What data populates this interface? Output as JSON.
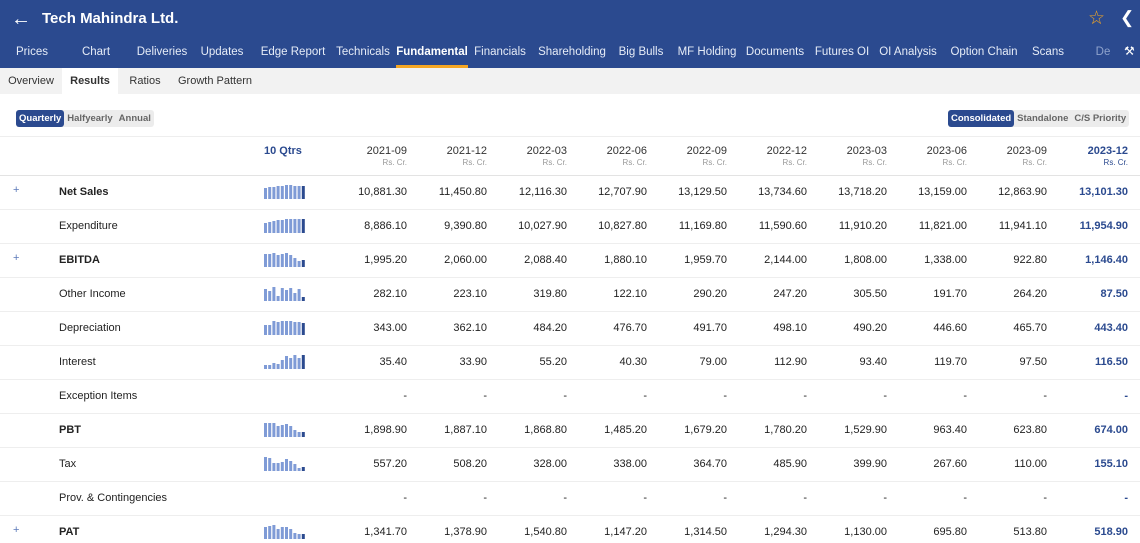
{
  "header": {
    "back_icon": "arrow-left-icon",
    "title": "Tech Mahindra Ltd.",
    "star_icon": "star-outline-icon",
    "share_icon": "share-icon",
    "settings_icon": "wrench-icon",
    "accent_color": "#2b4a8f",
    "highlight_color": "#f5a623"
  },
  "nav": {
    "tabs": [
      "Prices",
      "Chart",
      "Deliveries",
      "Updates",
      "Edge Report",
      "Technicals",
      "Fundamental",
      "Financials",
      "Shareholding",
      "Big Bulls",
      "MF Holding",
      "Documents",
      "Futures OI",
      "OI Analysis",
      "Option Chain",
      "Scans",
      "De"
    ],
    "active": "Fundamental"
  },
  "subnav": {
    "tabs": [
      "Overview",
      "Results",
      "Ratios",
      "Growth Pattern"
    ],
    "active": "Results"
  },
  "period_toggle": {
    "options": [
      "Quarterly",
      "Halfyearly",
      "Annual"
    ],
    "selected": "Quarterly"
  },
  "scope_toggle": {
    "options": [
      "Consolidated",
      "Standalone",
      "C/S Priority"
    ],
    "selected": "Consolidated"
  },
  "table": {
    "trend_header": "10 Qtrs",
    "unit": "Rs. Cr.",
    "periods": [
      "2021-09",
      "2021-12",
      "2022-03",
      "2022-06",
      "2022-09",
      "2022-12",
      "2023-03",
      "2023-06",
      "2023-09",
      "2023-12"
    ],
    "rows": [
      {
        "label": "Net Sales",
        "expandable": true,
        "bold": true,
        "values": [
          "10,881.30",
          "11,450.80",
          "12,116.30",
          "12,707.90",
          "13,129.50",
          "13,734.60",
          "13,718.20",
          "13,159.00",
          "12,863.90",
          "13,101.30"
        ],
        "spark": [
          10881.3,
          11450.8,
          12116.3,
          12707.9,
          13129.5,
          13734.6,
          13718.2,
          13159.0,
          12863.9,
          13101.3
        ]
      },
      {
        "label": "Expenditure",
        "expandable": false,
        "bold": false,
        "values": [
          "8,886.10",
          "9,390.80",
          "10,027.90",
          "10,827.80",
          "11,169.80",
          "11,590.60",
          "11,910.20",
          "11,821.00",
          "11,941.10",
          "11,954.90"
        ],
        "spark": [
          8886.1,
          9390.8,
          10027.9,
          10827.8,
          11169.8,
          11590.6,
          11910.2,
          11821.0,
          11941.1,
          11954.9
        ]
      },
      {
        "label": "EBITDA",
        "expandable": true,
        "bold": true,
        "values": [
          "1,995.20",
          "2,060.00",
          "2,088.40",
          "1,880.10",
          "1,959.70",
          "2,144.00",
          "1,808.00",
          "1,338.00",
          "922.80",
          "1,146.40"
        ],
        "spark": [
          1995.2,
          2060.0,
          2088.4,
          1880.1,
          1959.7,
          2144.0,
          1808.0,
          1338.0,
          922.8,
          1146.4
        ]
      },
      {
        "label": "Other Income",
        "expandable": false,
        "bold": false,
        "values": [
          "282.10",
          "223.10",
          "319.80",
          "122.10",
          "290.20",
          "247.20",
          "305.50",
          "191.70",
          "264.20",
          "87.50"
        ],
        "spark": [
          282.1,
          223.1,
          319.8,
          122.1,
          290.2,
          247.2,
          305.5,
          191.7,
          264.2,
          87.5
        ]
      },
      {
        "label": "Depreciation",
        "expandable": false,
        "bold": false,
        "values": [
          "343.00",
          "362.10",
          "484.20",
          "476.70",
          "491.70",
          "498.10",
          "490.20",
          "446.60",
          "465.70",
          "443.40"
        ],
        "spark": [
          343.0,
          362.1,
          484.2,
          476.7,
          491.7,
          498.1,
          490.2,
          446.6,
          465.7,
          443.4
        ]
      },
      {
        "label": "Interest",
        "expandable": false,
        "bold": false,
        "values": [
          "35.40",
          "33.90",
          "55.20",
          "40.30",
          "79.00",
          "112.90",
          "93.40",
          "119.70",
          "97.50",
          "116.50"
        ],
        "spark": [
          35.4,
          33.9,
          55.2,
          40.3,
          79.0,
          112.9,
          93.4,
          119.7,
          97.5,
          116.5
        ]
      },
      {
        "label": "Exception Items",
        "expandable": false,
        "bold": false,
        "values": [
          "-",
          "-",
          "-",
          "-",
          "-",
          "-",
          "-",
          "-",
          "-",
          "-"
        ],
        "spark": []
      },
      {
        "label": "PBT",
        "expandable": false,
        "bold": true,
        "values": [
          "1,898.90",
          "1,887.10",
          "1,868.80",
          "1,485.20",
          "1,679.20",
          "1,780.20",
          "1,529.90",
          "963.40",
          "623.80",
          "674.00"
        ],
        "spark": [
          1898.9,
          1887.1,
          1868.8,
          1485.2,
          1679.2,
          1780.2,
          1529.9,
          963.4,
          623.8,
          674.0
        ]
      },
      {
        "label": "Tax",
        "expandable": false,
        "bold": false,
        "values": [
          "557.20",
          "508.20",
          "328.00",
          "338.00",
          "364.70",
          "485.90",
          "399.90",
          "267.60",
          "110.00",
          "155.10"
        ],
        "spark": [
          557.2,
          508.2,
          328.0,
          338.0,
          364.7,
          485.9,
          399.9,
          267.6,
          110.0,
          155.1
        ]
      },
      {
        "label": "Prov. & Contingencies",
        "expandable": false,
        "bold": false,
        "values": [
          "-",
          "-",
          "-",
          "-",
          "-",
          "-",
          "-",
          "-",
          "-",
          "-"
        ],
        "spark": []
      },
      {
        "label": "PAT",
        "expandable": true,
        "bold": true,
        "values": [
          "1,341.70",
          "1,378.90",
          "1,540.80",
          "1,147.20",
          "1,314.50",
          "1,294.30",
          "1,130.00",
          "695.80",
          "513.80",
          "518.90"
        ],
        "spark": [
          1341.7,
          1378.9,
          1540.8,
          1147.2,
          1314.5,
          1294.3,
          1130.0,
          695.8,
          513.8,
          518.9
        ]
      }
    ]
  }
}
